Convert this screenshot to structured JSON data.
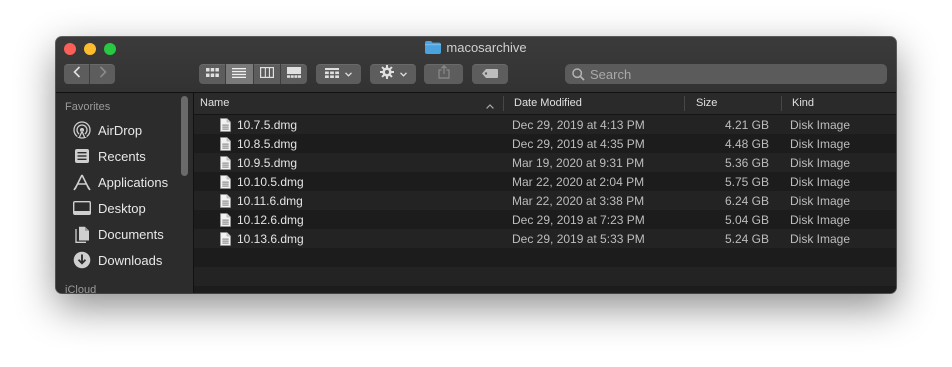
{
  "window": {
    "title": "macosarchive"
  },
  "toolbar": {
    "back_icon": "chevron-left-icon",
    "forward_icon": "chevron-right-icon",
    "views": [
      "icon-view",
      "list-view",
      "column-view",
      "gallery-view"
    ],
    "active_view": "list-view",
    "search_placeholder": "Search"
  },
  "sidebar": {
    "section": "Favorites",
    "items": [
      {
        "label": "AirDrop",
        "icon": "airdrop-icon"
      },
      {
        "label": "Recents",
        "icon": "recents-icon"
      },
      {
        "label": "Applications",
        "icon": "applications-icon"
      },
      {
        "label": "Desktop",
        "icon": "desktop-icon"
      },
      {
        "label": "Documents",
        "icon": "documents-icon"
      },
      {
        "label": "Downloads",
        "icon": "downloads-icon"
      }
    ],
    "section2": "iCloud"
  },
  "columns": {
    "name": "Name",
    "date": "Date Modified",
    "size": "Size",
    "kind": "Kind"
  },
  "files": [
    {
      "name": "10.7.5.dmg",
      "date": "Dec 29, 2019 at 4:13 PM",
      "size": "4.21 GB",
      "kind": "Disk Image"
    },
    {
      "name": "10.8.5.dmg",
      "date": "Dec 29, 2019 at 4:35 PM",
      "size": "4.48 GB",
      "kind": "Disk Image"
    },
    {
      "name": "10.9.5.dmg",
      "date": "Mar 19, 2020 at 9:31 PM",
      "size": "5.36 GB",
      "kind": "Disk Image"
    },
    {
      "name": "10.10.5.dmg",
      "date": "Mar 22, 2020 at 2:04 PM",
      "size": "5.75 GB",
      "kind": "Disk Image"
    },
    {
      "name": "10.11.6.dmg",
      "date": "Mar 22, 2020 at 3:38 PM",
      "size": "6.24 GB",
      "kind": "Disk Image"
    },
    {
      "name": "10.12.6.dmg",
      "date": "Dec 29, 2019 at 7:23 PM",
      "size": "5.04 GB",
      "kind": "Disk Image"
    },
    {
      "name": "10.13.6.dmg",
      "date": "Dec 29, 2019 at 5:33 PM",
      "size": "5.24 GB",
      "kind": "Disk Image"
    }
  ],
  "colors": {
    "close": "#fc5f57",
    "minimize": "#fdbc2e",
    "maximize": "#28c840",
    "folder": "#4aa3df",
    "sidebar_icon": "#cfcfcf"
  }
}
